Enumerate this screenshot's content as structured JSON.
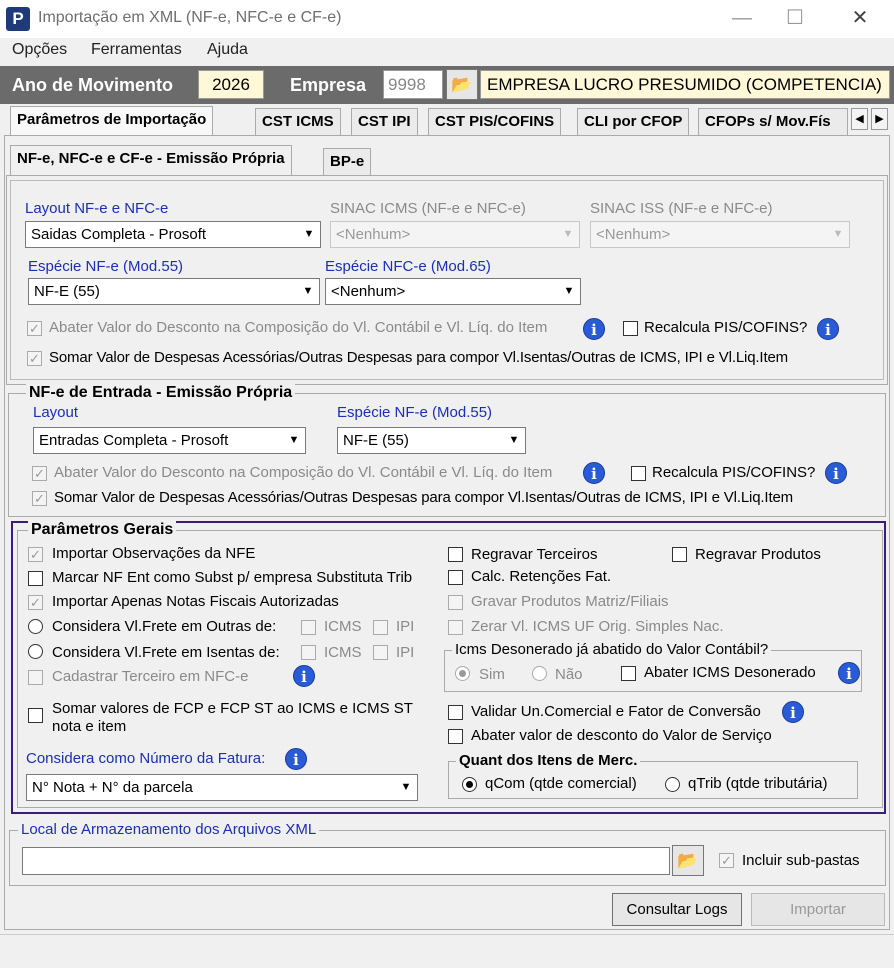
{
  "window": {
    "title": "Importação em XML (NF-e, NFC-e e CF-e)",
    "app_icon": "P"
  },
  "menu": [
    "Opções",
    "Ferramentas",
    "Ajuda"
  ],
  "header": {
    "ano_label": "Ano de Movimento",
    "ano_value": "2026",
    "empresa_label": "Empresa",
    "empresa_code": "9998",
    "empresa_name": "EMPRESA LUCRO PRESUMIDO (COMPETENCIA)"
  },
  "tabs": [
    "Parâmetros de Importação",
    "CST ICMS",
    "CST IPI",
    "CST PIS/COFINS",
    "CLI por CFOP",
    "CFOPs s/ Mov.Fís"
  ],
  "subtabs": [
    "NF-e, NFC-e e CF-e - Emissão Própria",
    "BP-e"
  ],
  "emissao": {
    "layout_label": "Layout NF-e e NFC-e",
    "layout_value": "Saidas Completa - Prosoft",
    "sinac_icms_label": "SINAC ICMS (NF-e e NFC-e)",
    "sinac_icms_value": "<Nenhum>",
    "sinac_iss_label": "SINAC ISS (NF-e e NFC-e)",
    "sinac_iss_value": "<Nenhum>",
    "especie_nfe_label": "Espécie NF-e (Mod.55)",
    "especie_nfe_value": "NF-E (55)",
    "especie_nfce_label": "Espécie NFC-e (Mod.65)",
    "especie_nfce_value": "<Nenhum>",
    "abater_label": "Abater Valor do Desconto na Composição do Vl. Contábil e Vl. Líq. do Item",
    "recalcula_label": "Recalcula PIS/COFINS?",
    "somar_label": "Somar Valor de Despesas Acessórias/Outras Despesas para compor Vl.Isentas/Outras de ICMS, IPI e Vl.Liq.Item"
  },
  "entrada": {
    "title": "NF-e de Entrada - Emissão Própria",
    "layout_label": "Layout",
    "layout_value": "Entradas Completa - Prosoft",
    "especie_label": "Espécie NF-e (Mod.55)",
    "especie_value": "NF-E (55)",
    "abater_label": "Abater Valor do Desconto na Composição do Vl. Contábil e Vl. Líq. do Item",
    "recalcula_label": "Recalcula PIS/COFINS?",
    "somar_label": "Somar Valor de Despesas Acessórias/Outras Despesas para compor Vl.Isentas/Outras de ICMS, IPI e Vl.Liq.Item"
  },
  "gerais": {
    "title": "Parâmetros Gerais",
    "importar_obs": "Importar Observações da NFE",
    "marcar_nf": "Marcar NF Ent como Subst p/ empresa Substituta Trib",
    "importar_autorizadas": "Importar Apenas Notas Fiscais Autorizadas",
    "frete_outras": "Considera Vl.Frete em Outras de:",
    "frete_isentas": "Considera Vl.Frete em Isentas de:",
    "icms": "ICMS",
    "ipi": "IPI",
    "cadastrar": "Cadastrar Terceiro em NFC-e",
    "somar_fcp": "Somar valores de FCP e FCP ST ao ICMS e ICMS ST nota e item",
    "fatura_label": "Considera como Número da Fatura:",
    "fatura_value": "N° Nota + N° da parcela",
    "regravar_terceiros": "Regravar Terceiros",
    "regravar_produtos": "Regravar Produtos",
    "calc_retencoes": "Calc. Retenções Fat.",
    "gravar_produtos": "Gravar Produtos Matriz/Filiais",
    "zerar": "Zerar Vl. ICMS UF Orig. Simples Nac.",
    "desonerado_title": "Icms Desonerado já abatido do Valor Contábil?",
    "sim": "Sim",
    "nao": "Não",
    "abater_desonerado": "Abater ICMS Desonerado",
    "validar": "Validar Un.Comercial e Fator de Conversão",
    "abater_servico": "Abater valor de desconto do Valor de Serviço",
    "quant_title": "Quant dos Itens de Merc.",
    "qcom": "qCom (qtde comercial)",
    "qtrib": "qTrib (qtde tributária)"
  },
  "local": {
    "title": "Local de Armazenamento dos Arquivos XML",
    "path": "",
    "incluir": "Incluir sub-pastas"
  },
  "buttons": {
    "consultar": "Consultar Logs",
    "importar": "Importar"
  },
  "colors": {
    "accent_blue": "#1a2fb8",
    "group_border": "#3a1d7a",
    "header_bg": "#6b6b6b",
    "highlight_field": "#fff8d8"
  }
}
